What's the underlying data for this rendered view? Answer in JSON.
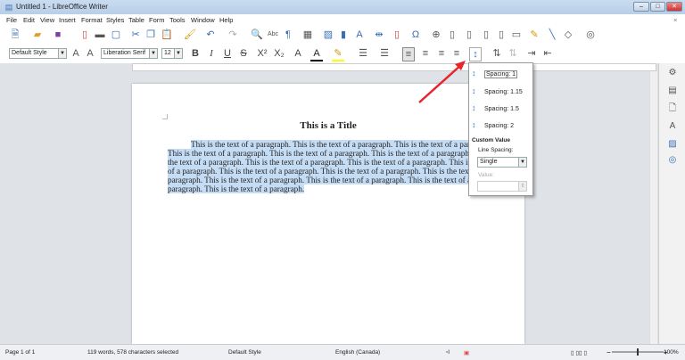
{
  "window": {
    "title": "Untitled 1 - LibreOffice Writer",
    "min": "–",
    "max": "□",
    "close": "✕"
  },
  "menu": [
    "File",
    "Edit",
    "View",
    "Insert",
    "Format",
    "Styles",
    "Table",
    "Form",
    "Tools",
    "Window",
    "Help"
  ],
  "toolbar": {
    "paragraph_style": "Default Style",
    "font_name": "Liberation Serif",
    "font_size": "12"
  },
  "document": {
    "title": "This is a Title",
    "lines": [
      "This is the text of a paragraph.  This is the text of a paragraph.  This is the text of a paragraph.",
      "This is the text of a paragraph.  This is the text of a paragraph.  This is the text of a paragraph.  This is",
      "the text of a paragraph.  This is the text of a paragraph.  This is the text of a paragraph.  This is the text",
      "of a paragraph.  This is the text of a paragraph.  This is the text of a paragraph.  This is the text of a",
      "paragraph.  This is the text of a paragraph.  This is the text of a paragraph.  This is the text of a",
      "paragraph.  This is the text of a paragraph."
    ]
  },
  "spacing_menu": {
    "options": [
      "Spacing: 1",
      "Spacing: 1.15",
      "Spacing: 1.5",
      "Spacing: 2"
    ],
    "custom_header": "Custom Value",
    "line_spacing_label": "Line Spacing:",
    "line_spacing_value": "Single",
    "value_label": "Value:",
    "value": ""
  },
  "status": {
    "page": "Page 1 of 1",
    "words": "119 words, 578 characters selected",
    "style": "Default Style",
    "language": "English (Canada)",
    "zoom": "100%"
  },
  "colors": {
    "selection": "#c5dcf5",
    "annotation_arrow": "#e8242c",
    "accent": "#3a6fb5"
  }
}
